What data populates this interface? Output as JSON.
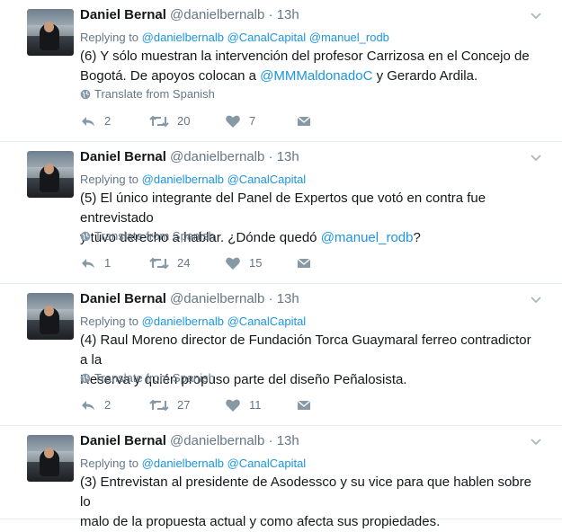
{
  "tweets": [
    {
      "name": "Daniel Bernal",
      "handle": "@danielbernalb",
      "dot": "·",
      "time": "13h",
      "reply_prefix": "Replying to",
      "reply_handles": [
        "@danielbernalb",
        "@CanalCapital",
        "@manuel_rodb"
      ],
      "text_lines": [
        [
          {
            "t": "(6) Y sólo muestran la intervención del profesor Carrizosa en el Concejo de",
            "m": false
          }
        ],
        [
          {
            "t": "Bogotá. De apoyos colocan a ",
            "m": false
          },
          {
            "t": "@MMMaldonadoC",
            "m": true
          },
          {
            "t": " y Gerardo Ardila.",
            "m": false
          }
        ]
      ],
      "translate": "Translate from Spanish",
      "replies": "2",
      "retweets": "20",
      "likes": "7"
    },
    {
      "name": "Daniel Bernal",
      "handle": "@danielbernalb",
      "dot": "·",
      "time": "13h",
      "reply_prefix": "Replying to",
      "reply_handles": [
        "@danielbernalb",
        "@CanalCapital"
      ],
      "text_lines": [
        [
          {
            "t": "(5) El único integrante del Panel de Expertos que votó en contra fue entrevistado",
            "m": false
          }
        ],
        [
          {
            "t": "y tuvo derecho a hablar. ¿Dónde quedó ",
            "m": false
          },
          {
            "t": "@manuel_rodb",
            "m": true
          },
          {
            "t": "?",
            "m": false
          }
        ]
      ],
      "translate": "Translate from Spanish",
      "replies": "1",
      "retweets": "24",
      "likes": "15"
    },
    {
      "name": "Daniel Bernal",
      "handle": "@danielbernalb",
      "dot": "·",
      "time": "13h",
      "reply_prefix": "Replying to",
      "reply_handles": [
        "@danielbernalb",
        "@CanalCapital"
      ],
      "text_lines": [
        [
          {
            "t": "(4) Raul Moreno director de Fundación Torca Guaymaral ferreo contradictor a la",
            "m": false
          }
        ],
        [
          {
            "t": "Reserva y quién propuso parte del diseño Peñalosista.",
            "m": false
          }
        ]
      ],
      "translate": "Translate from Spanish",
      "replies": "2",
      "retweets": "27",
      "likes": "11"
    },
    {
      "name": "Daniel Bernal",
      "handle": "@danielbernalb",
      "dot": "·",
      "time": "13h",
      "reply_prefix": "Replying to",
      "reply_handles": [
        "@danielbernalb",
        "@CanalCapital"
      ],
      "text_lines": [
        [
          {
            "t": "(3) Entrevistan al presidente de Asodessco y su vice para que hablen sobre lo",
            "m": false
          }
        ],
        [
          {
            "t": "malo de la propuesta actual y como afecta sus propiedades.",
            "m": false
          }
        ]
      ],
      "translate": "",
      "replies": "",
      "retweets": "",
      "likes": ""
    }
  ],
  "icons": {
    "avatar": "profile-photo",
    "caret": "chevron-down-icon",
    "globe": "globe-icon",
    "reply": "reply-icon",
    "retweet": "retweet-icon",
    "like": "heart-icon",
    "dm": "envelope-icon"
  },
  "colors": {
    "link": "#1b95e0",
    "muted": "#657786",
    "text": "#14171a",
    "divider": "#e6ecf0"
  }
}
